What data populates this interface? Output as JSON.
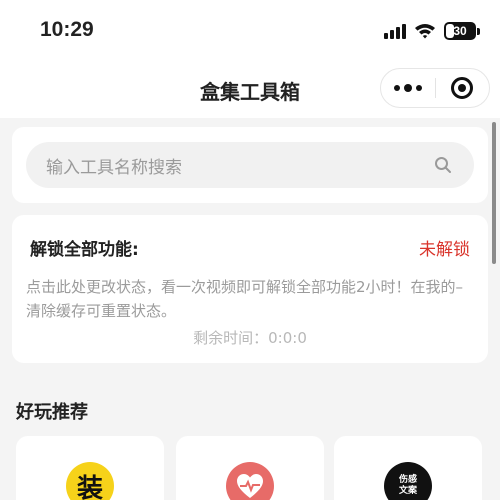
{
  "status_bar": {
    "time": "10:29",
    "battery": "30"
  },
  "nav": {
    "title": "盒集工具箱"
  },
  "search": {
    "placeholder": "输入工具名称搜索"
  },
  "unlock": {
    "title": "解锁全部功能:",
    "status": "未解锁",
    "description": "点击此处更改状态，看一次视频即可解锁全部功能2小时！在我的–清除缓存可重置状态。",
    "remaining": "剩余时间：0:0:0"
  },
  "section": {
    "title": "好玩推荐"
  },
  "tools": [
    {
      "icon_text": "装",
      "icon": "zhuang-logo-icon",
      "color": "#f6d21a"
    },
    {
      "icon": "heart-pulse-icon",
      "color": "#e76b68"
    },
    {
      "icon_text": "伤感文案",
      "icon": "quote-logo-icon",
      "color": "#111111"
    }
  ],
  "colors": {
    "accent_red": "#d9342b",
    "background": "#f4f4f4"
  }
}
